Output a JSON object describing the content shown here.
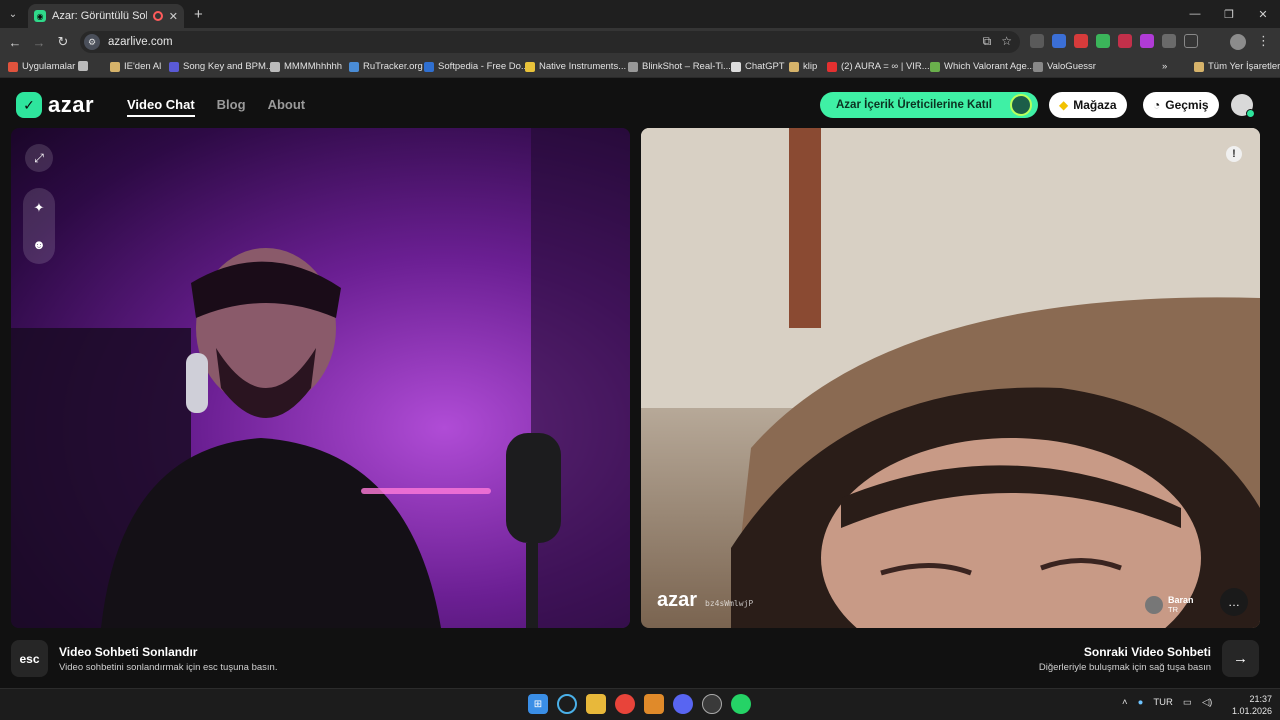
{
  "browser": {
    "tab_title": "Azar: Görüntülü Sohbet & ",
    "url": "azarlive.com",
    "bookmarks": [
      {
        "label": "Uygulamalar",
        "color": "#e0533d"
      },
      {
        "label": "IE'den Al",
        "color": "#d6b36a"
      },
      {
        "label": "Song Key and BPM...",
        "color": "#5a5ad6"
      },
      {
        "label": "MMMMhhhhh",
        "color": "#bbbbbb"
      },
      {
        "label": "RuTracker.org",
        "color": "#4a8cd6"
      },
      {
        "label": "Softpedia - Free Do...",
        "color": "#2f6fd0"
      },
      {
        "label": "Native Instruments...",
        "color": "#e8c23a"
      },
      {
        "label": "BlinkShot – Real-Ti...",
        "color": "#999999"
      },
      {
        "label": "ChatGPT",
        "color": "#dddddd"
      },
      {
        "label": "klip",
        "color": "#d6b36a"
      },
      {
        "label": "(2) AURA = ∞ | VIR...",
        "color": "#e53030"
      },
      {
        "label": "Which Valorant Age...",
        "color": "#6ab04c"
      },
      {
        "label": "ValoGuessr",
        "color": "#888888"
      }
    ],
    "all_bookmarks": "Tüm Yer İşaretleri"
  },
  "azar": {
    "logo": "azar",
    "nav": {
      "video_chat": "Video Chat",
      "blog": "Blog",
      "about": "About"
    },
    "creator_button": "Azar İçerik Üreticilerine Katıl",
    "shop_button": "Mağaza",
    "history_button": "Geçmiş",
    "watermark": "azar",
    "watermark_id": "bz4sWmlwjP",
    "peer": {
      "name": "Baran",
      "country": "TR"
    },
    "bottom": {
      "esc_key": "esc",
      "end_title": "Video Sohbeti Sonlandır",
      "end_desc": "Video sohbetini sonlandırmak için esc tuşuna basın.",
      "next_title": "Sonraki Video Sohbeti",
      "next_desc": "Diğerleriyle buluşmak için sağ tuşa basın"
    }
  },
  "taskbar": {
    "language": "TUR",
    "time": "21:37",
    "date": "1.01.2026"
  }
}
